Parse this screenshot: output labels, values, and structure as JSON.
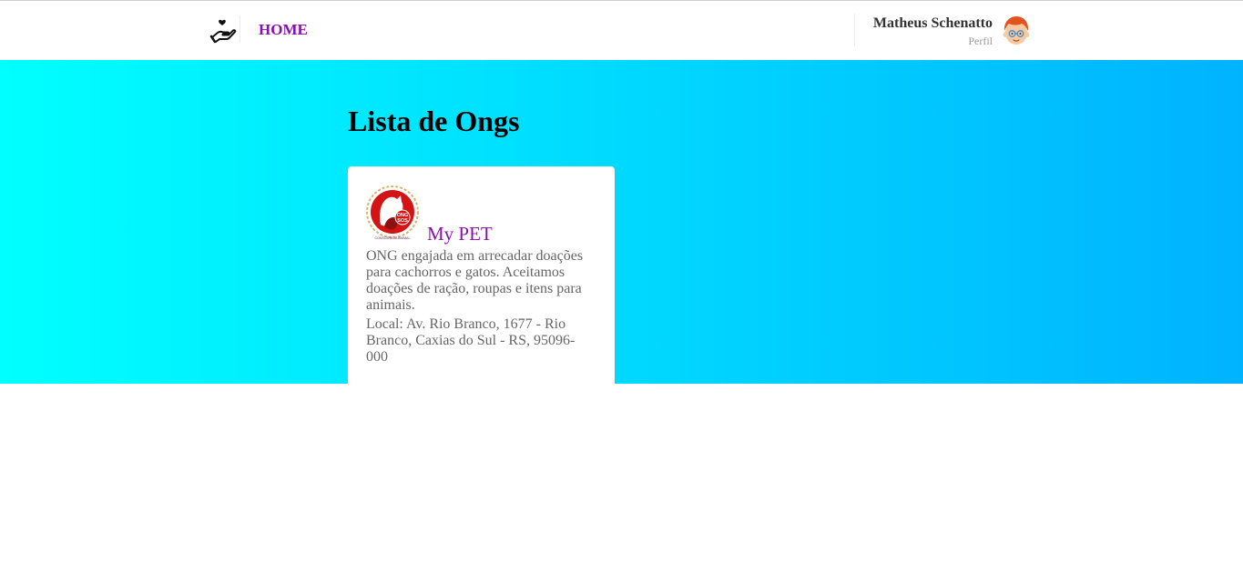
{
  "navbar": {
    "logo_icon": "hand-heart-icon",
    "home_label": "HOME",
    "user_name": "Matheus Schenatto",
    "profile_label": "Perfil",
    "avatar_icon": "avatar-boy-icon"
  },
  "main": {
    "title": "Lista de Ongs",
    "ongs": [
      {
        "logo_icon": "ong-sos-logo",
        "logo_text": [
          "ONG",
          "SOS",
          "CONSCIENCIA ANIMAL"
        ],
        "name": "My PET",
        "description": "ONG engajada em arrecadar doações para cachorros e gatos. Aceitamos doações de ração, roupas e itens para animais.",
        "local": "Local: Av. Rio Branco, 1677 - Rio Branco, Caxias do Sul - RS, 95096-000"
      }
    ]
  },
  "colors": {
    "accent": "#8a0fb3",
    "gradient_start": "#00ffff",
    "gradient_end": "#00b3ff"
  }
}
